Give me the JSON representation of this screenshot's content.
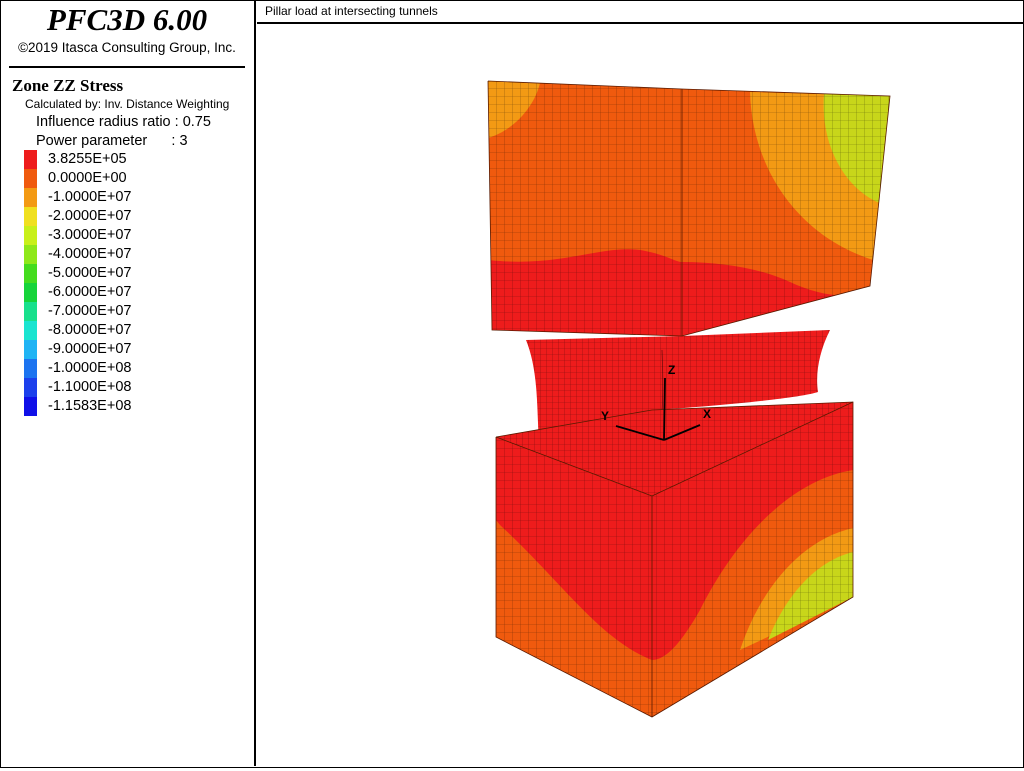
{
  "app": {
    "product": "PFC3D 6.00",
    "copyright": "©2019 Itasca Consulting Group, Inc."
  },
  "view": {
    "title": "Pillar load at intersecting tunnels"
  },
  "legend": {
    "title": "Zone ZZ Stress",
    "calculated_by": "Calculated by: Inv. Distance Weighting",
    "influence_radius": "Influence radius ratio : 0.75",
    "power_parameter": "Power parameter      : 3",
    "items": [
      {
        "label": "3.8255E+05",
        "color": "#ee1c1c"
      },
      {
        "label": "0.0000E+00",
        "color": "#f05a0e"
      },
      {
        "label": "-1.0000E+07",
        "color": "#f39a14"
      },
      {
        "label": "-2.0000E+07",
        "color": "#f0e020"
      },
      {
        "label": "-3.0000E+07",
        "color": "#c8f01a"
      },
      {
        "label": "-4.0000E+07",
        "color": "#8ee81a"
      },
      {
        "label": "-5.0000E+07",
        "color": "#44dc1e"
      },
      {
        "label": "-6.0000E+07",
        "color": "#16d43a"
      },
      {
        "label": "-7.0000E+07",
        "color": "#18e08c"
      },
      {
        "label": "-8.0000E+07",
        "color": "#1ae4d0"
      },
      {
        "label": "-9.0000E+07",
        "color": "#20b4f4"
      },
      {
        "label": "-1.0000E+08",
        "color": "#1c74f0"
      },
      {
        "label": "-1.1000E+08",
        "color": "#1c40ec"
      },
      {
        "label": "-1.1583E+08",
        "color": "#1010e8"
      }
    ]
  },
  "axes": {
    "x": "X",
    "y": "Y",
    "z": "Z"
  }
}
